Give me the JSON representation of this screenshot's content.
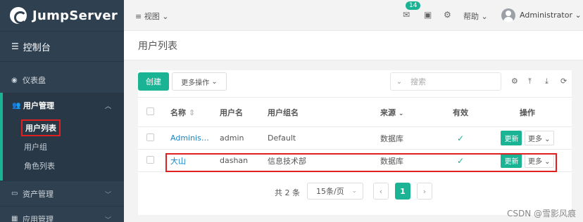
{
  "sidebar": {
    "logo": "JumpServer",
    "console": "控制台",
    "items": [
      {
        "label": "仪表盘"
      },
      {
        "label": "用户管理"
      },
      {
        "label": "资产管理"
      },
      {
        "label": "应用管理"
      }
    ],
    "subitems": [
      "用户列表",
      "用户组",
      "角色列表"
    ]
  },
  "topbar": {
    "view": "视图",
    "badge": "14",
    "help": "帮助",
    "user": "Administrator"
  },
  "page": {
    "title": "用户列表"
  },
  "toolbar": {
    "create": "创建",
    "more_ops": "更多操作",
    "search_placeholder": "搜索"
  },
  "table": {
    "headers": [
      "名称",
      "用户名",
      "用户组名",
      "来源",
      "有效",
      "操作"
    ],
    "rows": [
      {
        "name": "Adminis…",
        "username": "admin",
        "group": "Default",
        "source": "数据库",
        "update": "更新",
        "more": "更多"
      },
      {
        "name": "大山",
        "username": "dashan",
        "group": "信息技术部",
        "source": "数据库",
        "update": "更新",
        "more": "更多"
      }
    ]
  },
  "pager": {
    "total": "共 2 条",
    "page_size": "15条/页",
    "current": "1"
  },
  "watermark": "CSDN @雪影风痕",
  "colors": {
    "accent": "#1ab394",
    "sidebar": "#2f4050",
    "highlight": "#e02020"
  }
}
